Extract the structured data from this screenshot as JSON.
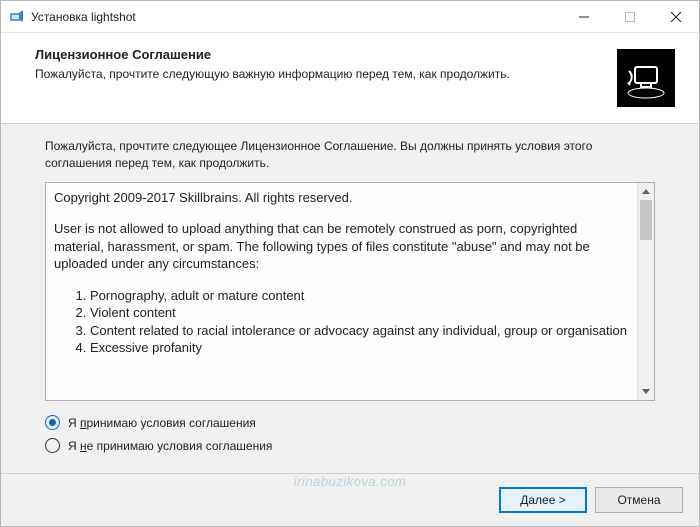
{
  "titlebar": {
    "title": "Установка lightshot"
  },
  "header": {
    "title": "Лицензионное Соглашение",
    "subtitle": "Пожалуйста, прочтите следующую важную информацию перед тем, как продолжить."
  },
  "content": {
    "instruction": "Пожалуйста, прочтите следующее Лицензионное Соглашение. Вы должны принять условия этого соглашения перед тем, как продолжить.",
    "license": {
      "copyright": "Copyright 2009-2017 Skillbrains. All rights reserved.",
      "intro": "User is not allowed to upload anything that can be remotely construed as porn, copyrighted material, harassment, or spam. The following types of files constitute \"abuse\" and may not be uploaded under any circumstances:",
      "items": [
        "Pornography, adult or mature content",
        "Violent content",
        "Content related to racial intolerance or advocacy against any individual, group or organisation",
        "Excessive profanity"
      ]
    },
    "radios": {
      "accept_pre": "Я ",
      "accept_u": "п",
      "accept_post": "ринимаю условия соглашения",
      "decline_pre": "Я ",
      "decline_u": "н",
      "decline_post": "е принимаю условия соглашения"
    }
  },
  "footer": {
    "next_pre": "",
    "next_u": "Д",
    "next_post": "алее >",
    "cancel": "Отмена"
  },
  "watermark": "irinabuzikova.com"
}
